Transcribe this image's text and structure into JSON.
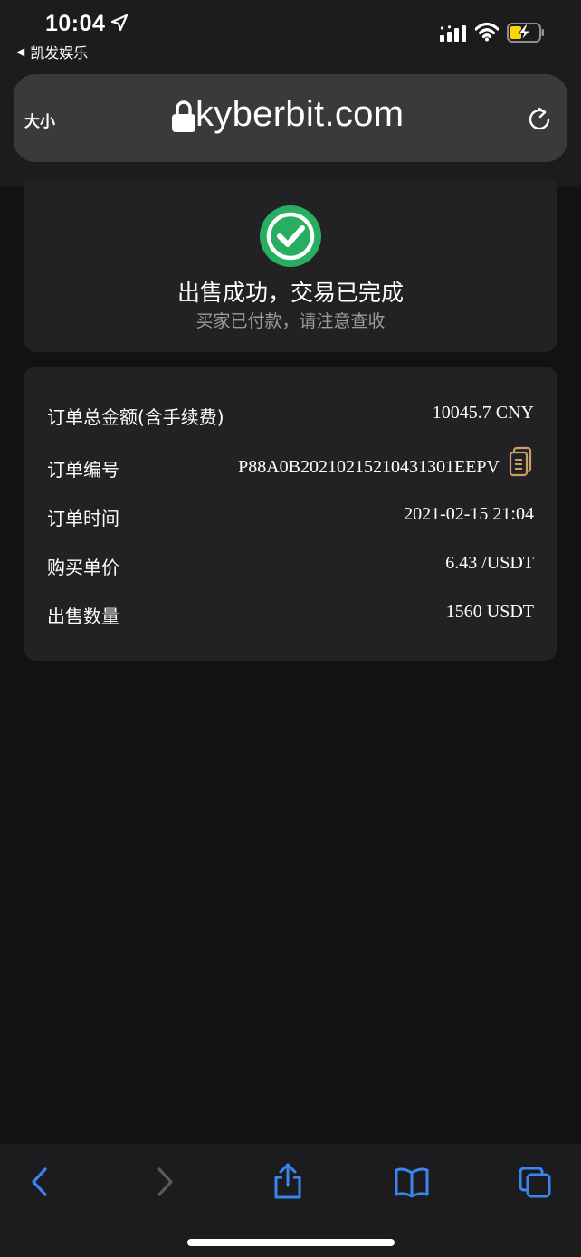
{
  "status_bar": {
    "time": "10:04",
    "back_app": "凯发娱乐"
  },
  "browser": {
    "text_size_label": "大小",
    "domain": "kyberbit.com"
  },
  "result": {
    "title": "出售成功，交易已完成",
    "subtitle": "买家已付款，请注意查收"
  },
  "order": {
    "rows": [
      {
        "label": "订单总金额(含手续费)",
        "value": "10045.7 CNY"
      },
      {
        "label": "订单编号",
        "value": "P88A0B20210215210431301EEPV"
      },
      {
        "label": "订单时间",
        "value": "2021-02-15 21:04"
      },
      {
        "label": "购买单价",
        "value": "6.43 /USDT"
      },
      {
        "label": "出售数量",
        "value": "1560 USDT"
      }
    ]
  },
  "colors": {
    "accent_blue": "#3a86f0",
    "success_green": "#27ae60",
    "copy_icon": "#c9a06a",
    "battery_yellow": "#ffd60a"
  },
  "icons": {
    "toolbar": [
      "back-icon",
      "forward-icon",
      "share-icon",
      "bookmarks-icon",
      "tabs-icon"
    ]
  }
}
